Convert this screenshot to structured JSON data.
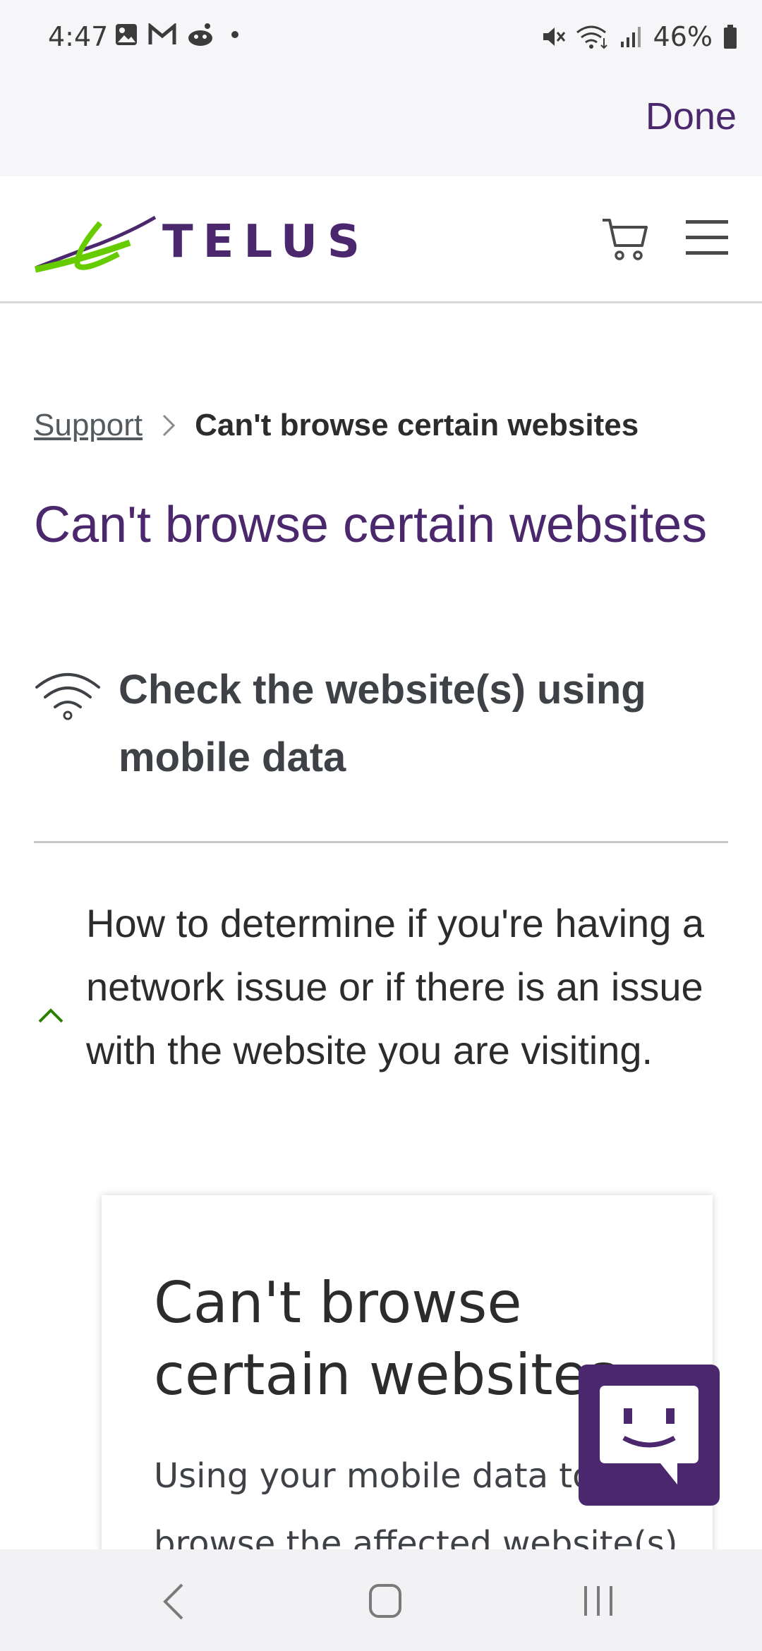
{
  "status_bar": {
    "time": "4:47",
    "battery": "46%",
    "icons_left": [
      "gallery-icon",
      "gmail-icon",
      "reddit-icon",
      "dot-icon"
    ],
    "icons_right": [
      "mute-icon",
      "wifi-signal-icon",
      "cell-signal-icon",
      "battery-icon"
    ]
  },
  "browser": {
    "done_label": "Done"
  },
  "header": {
    "logo_text": "TELUS",
    "brand_color": "#4b286d",
    "accent_color": "#66cc00"
  },
  "breadcrumb": {
    "link_label": "Support",
    "current_label": "Can't browse certain websites"
  },
  "page": {
    "title": "Can't browse certain websites",
    "section_heading": "Check the website(s) using mobile data",
    "accordion_text": "How to determine if you're having a network issue or if there is an issue with the website you are visiting."
  },
  "card": {
    "title": "Can't browse certain websites",
    "body": "Using your mobile data to browse the affected website(s) will help"
  }
}
